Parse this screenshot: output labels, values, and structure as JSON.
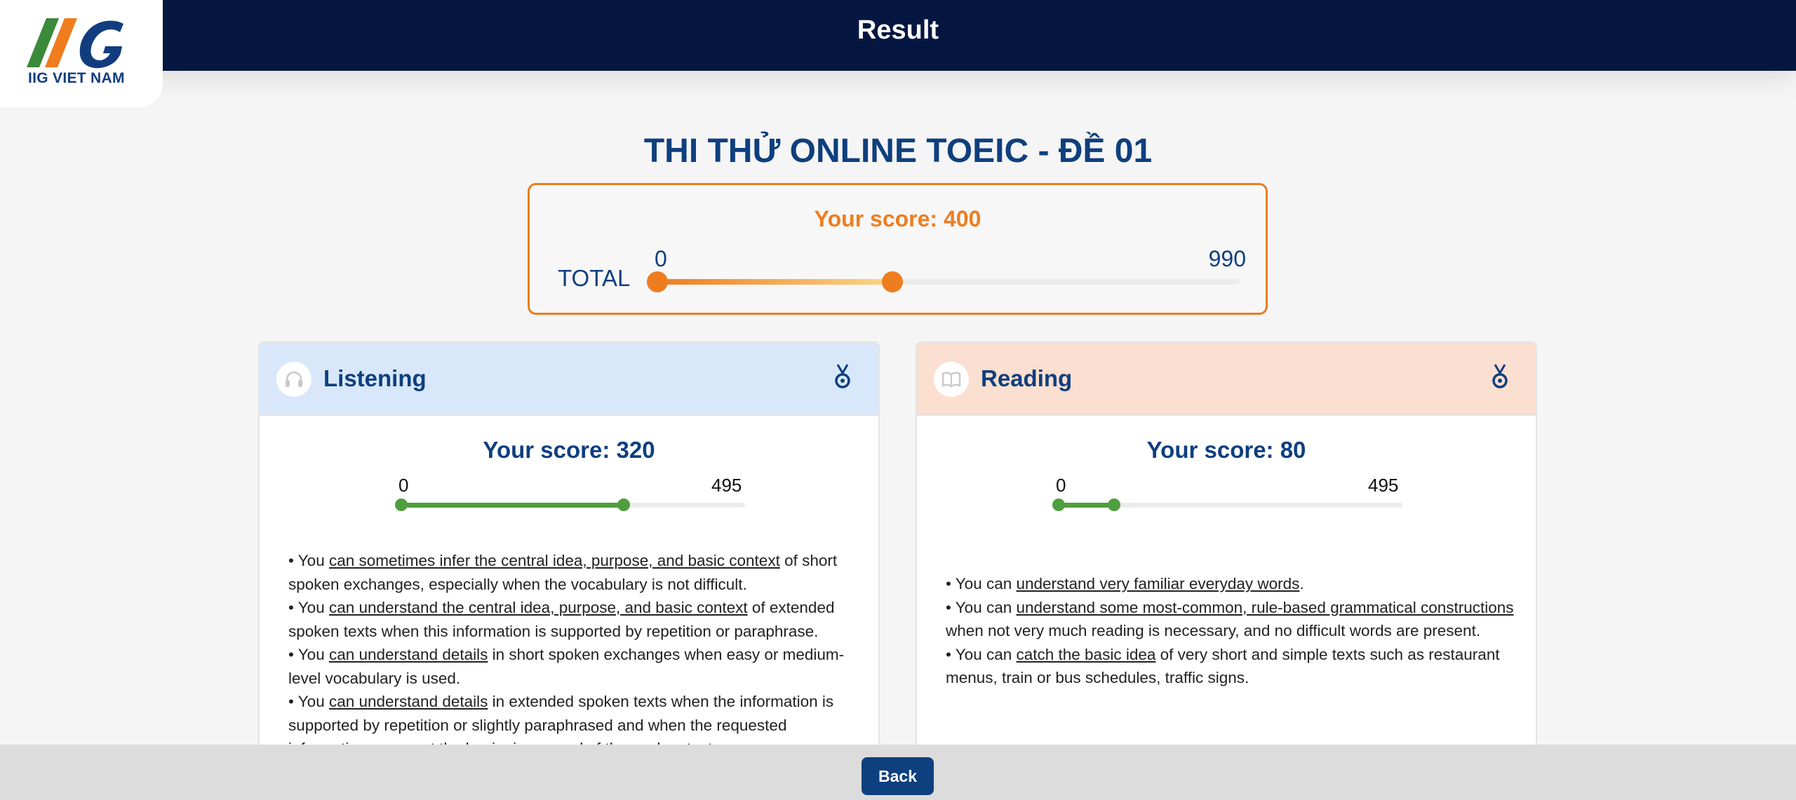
{
  "header": {
    "title": "Result",
    "logo_text": "IIG VIET NAM"
  },
  "exam": {
    "title": "THI THỬ ONLINE TOEIC - ĐỀ 01"
  },
  "total": {
    "score_text": "Your score: 400",
    "label": "TOTAL",
    "min": "0",
    "max": "990",
    "fraction": 0.404
  },
  "listening": {
    "title": "Listening",
    "score_text": "Your score: 320",
    "min": "0",
    "max": "495",
    "fraction": 0.646,
    "items": [
      {
        "pre": "You ",
        "u": "can sometimes infer the central idea, purpose, and basic context",
        "post": " of short spoken exchanges, especially when the vocabulary is not difficult."
      },
      {
        "pre": "You ",
        "u": "can understand the central idea, purpose, and basic context",
        "post": " of extended spoken texts when this information is supported by repetition or paraphrase."
      },
      {
        "pre": "You ",
        "u": "can understand details",
        "post": " in short spoken exchanges when easy or medium-level vocabulary is used."
      },
      {
        "pre": "You ",
        "u": "can understand details",
        "post": " in extended spoken texts when the information is supported by repetition or slightly paraphrased and when the requested information comes at the beginning or end of the spoken text."
      }
    ]
  },
  "reading": {
    "title": "Reading",
    "score_text": "Your score: 80",
    "min": "0",
    "max": "495",
    "fraction": 0.162,
    "items": [
      {
        "pre": "You can ",
        "u": "understand very familiar everyday words",
        "post": "."
      },
      {
        "pre": "You can ",
        "u": "understand some most-common, rule-based grammatical constructions",
        "post": " when not very much reading is necessary, and no difficult words are present."
      },
      {
        "pre": "You can ",
        "u": "catch the basic idea",
        "post": " of very short and simple texts such as restaurant menus, train or bus schedules, traffic signs."
      }
    ]
  },
  "footer": {
    "back_label": "Back"
  },
  "colors": {
    "navy": "#051641",
    "brand_blue": "#0e3f7e",
    "orange": "#ee7d1f",
    "green": "#4f9e3e",
    "listening_head": "#d8e8fa",
    "reading_head": "#fbdfd0"
  },
  "icons": {
    "listening": "headphones-icon",
    "reading": "book-icon",
    "medal": "medal-icon"
  }
}
